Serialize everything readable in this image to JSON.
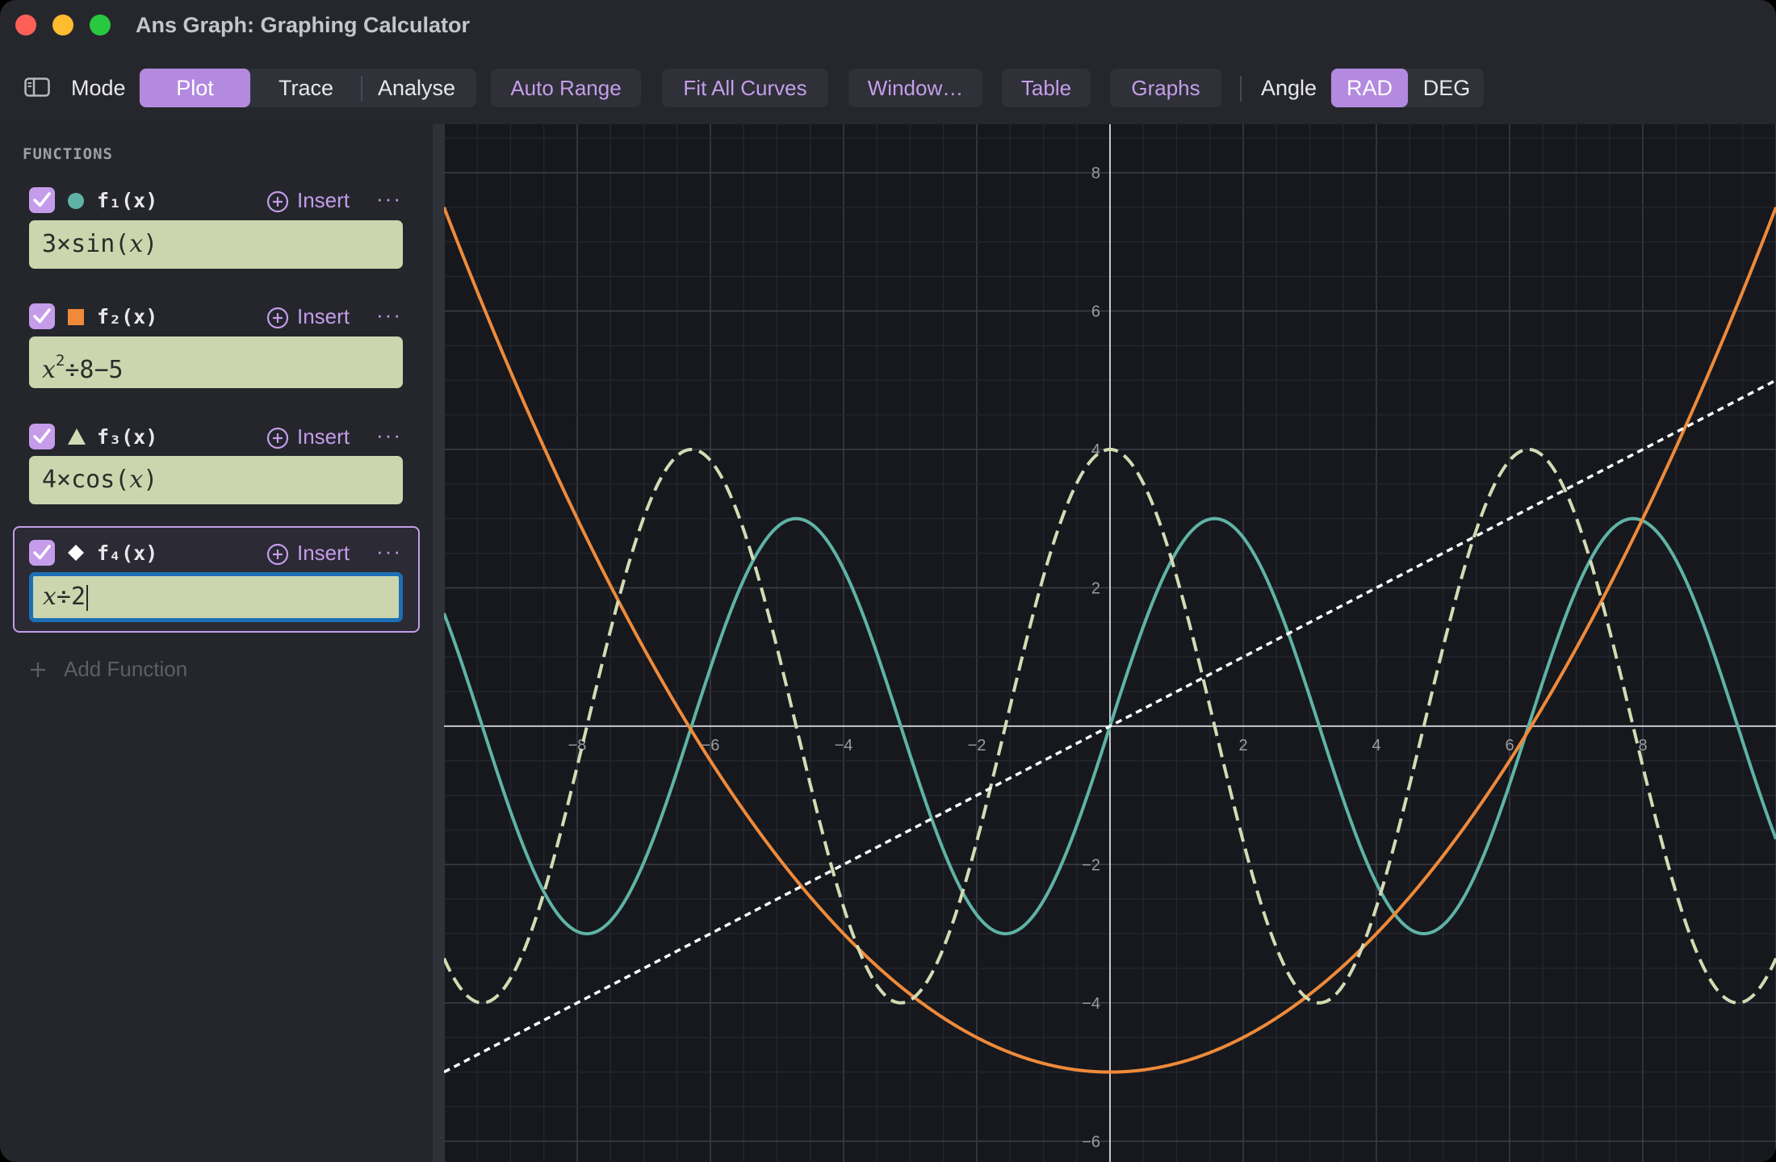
{
  "window": {
    "title": "Ans Graph: Graphing Calculator"
  },
  "toolbar": {
    "mode_label": "Mode",
    "modes": [
      "Plot",
      "Trace",
      "Analyse"
    ],
    "selected_mode": "Plot",
    "buttons": {
      "auto_range": "Auto Range",
      "fit_all_curves": "Fit All Curves",
      "window": "Window…",
      "table": "Table",
      "graphs": "Graphs"
    },
    "angle_label": "Angle",
    "angle_units": [
      "RAD",
      "DEG"
    ],
    "selected_angle": "RAD"
  },
  "sidebar": {
    "section_title": "FUNCTIONS",
    "insert_label": "Insert",
    "more_label": "···",
    "add_function_label": "Add Function",
    "functions": [
      {
        "name": "f₁(x)",
        "enabled": true,
        "marker": "circle",
        "color": "#5fb3a6",
        "line_style": "solid",
        "expr_prefix": "3×sin(",
        "expr_var": "x",
        "expr_suffix": ")"
      },
      {
        "name": "f₂(x)",
        "enabled": true,
        "marker": "square",
        "color": "#ef8a3a",
        "line_style": "solid",
        "expr_var": "x",
        "expr_exp": "2",
        "expr_suffix": "÷8−5"
      },
      {
        "name": "f₃(x)",
        "enabled": true,
        "marker": "triangle",
        "color": "#d3dbb4",
        "line_style": "dashed",
        "expr_prefix": "4×cos(",
        "expr_var": "x",
        "expr_suffix": ")"
      },
      {
        "name": "f₄(x)",
        "enabled": true,
        "marker": "diamond",
        "color": "#ffffff",
        "line_style": "dotted",
        "expr_var": "x",
        "expr_suffix": "÷2",
        "active": true
      }
    ]
  },
  "chart_data": {
    "type": "line",
    "xlim": [
      -10,
      10
    ],
    "ylim": [
      -6.3,
      8.7
    ],
    "x_ticks": [
      -8,
      -6,
      -4,
      -2,
      2,
      4,
      6,
      8
    ],
    "y_ticks": [
      -6,
      -4,
      -2,
      2,
      4,
      6,
      8
    ],
    "grid": true,
    "series": [
      {
        "name": "f₁(x)",
        "formula": "3×sin(x)",
        "color": "#5fb3a6",
        "style": "solid"
      },
      {
        "name": "f₂(x)",
        "formula": "x²÷8−5",
        "color": "#ef8a3a",
        "style": "solid"
      },
      {
        "name": "f₃(x)",
        "formula": "4×cos(x)",
        "color": "#d3dbb4",
        "style": "dashed"
      },
      {
        "name": "f₄(x)",
        "formula": "x÷2",
        "color": "#ffffff",
        "style": "dotted"
      }
    ]
  }
}
